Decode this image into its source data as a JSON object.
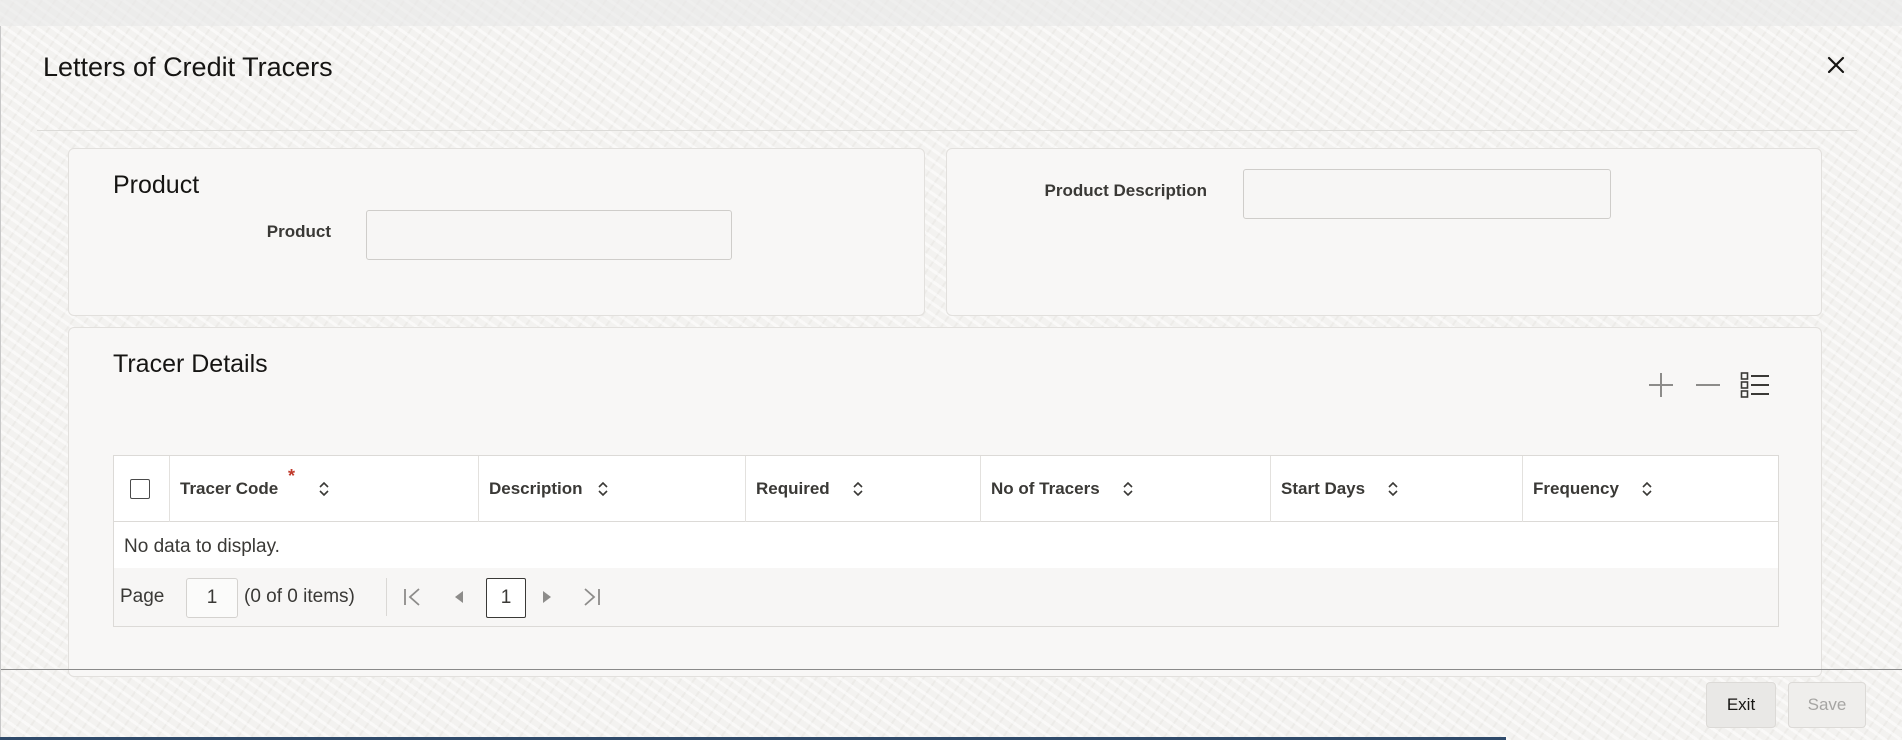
{
  "dialog": {
    "title": "Letters of Credit Tracers",
    "close_icon": "close-icon"
  },
  "product_section": {
    "heading": "Product",
    "product_label": "Product",
    "product_value": ""
  },
  "description_section": {
    "label": "Product Description",
    "value": ""
  },
  "tracer_details": {
    "heading": "Tracer Details",
    "toolbar": {
      "add_icon": "plus-icon",
      "remove_icon": "minus-icon",
      "columns_icon": "list-icon"
    },
    "columns": [
      {
        "label": "Tracer Code",
        "required": true
      },
      {
        "label": "Description",
        "required": false
      },
      {
        "label": "Required",
        "required": false
      },
      {
        "label": "No of Tracers",
        "required": false
      },
      {
        "label": "Start Days",
        "required": false
      },
      {
        "label": "Frequency",
        "required": false
      }
    ],
    "required_marker": "*",
    "empty_message": "No data to display.",
    "pagination": {
      "page_label": "Page",
      "page_value": "1",
      "count_text": "(0 of 0 items)",
      "current_page": "1"
    }
  },
  "footer": {
    "exit_label": "Exit",
    "save_label": "Save"
  }
}
